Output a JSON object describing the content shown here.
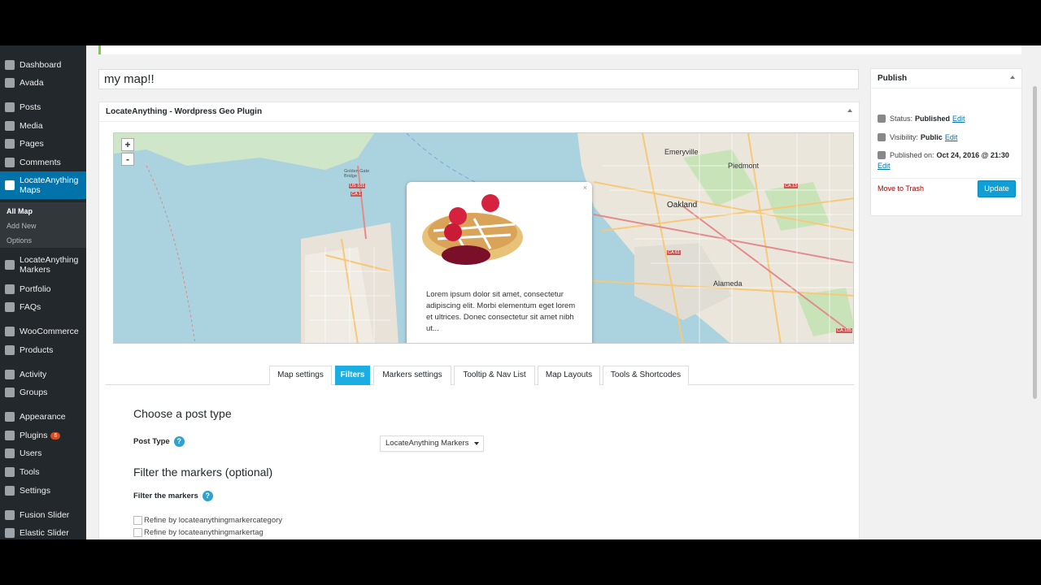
{
  "title_input": {
    "value": "my map!!"
  },
  "sidebar": {
    "items": [
      {
        "label": "Dashboard",
        "icon": "dashboard-icon"
      },
      {
        "label": "Avada",
        "icon": "avada-icon"
      },
      {
        "label": "Posts",
        "icon": "pin-icon"
      },
      {
        "label": "Media",
        "icon": "media-icon"
      },
      {
        "label": "Pages",
        "icon": "pages-icon"
      },
      {
        "label": "Comments",
        "icon": "comments-icon"
      },
      {
        "label": "LocateAnything Maps",
        "icon": "globe-icon",
        "active": true
      },
      {
        "label": "LocateAnything Markers",
        "icon": "pin-icon"
      },
      {
        "label": "Portfolio",
        "icon": "pin-icon"
      },
      {
        "label": "FAQs",
        "icon": "pin-icon"
      },
      {
        "label": "WooCommerce",
        "icon": "woocommerce-icon"
      },
      {
        "label": "Products",
        "icon": "products-icon"
      },
      {
        "label": "Activity",
        "icon": "activity-icon"
      },
      {
        "label": "Groups",
        "icon": "groups-icon"
      },
      {
        "label": "Appearance",
        "icon": "brush-icon"
      },
      {
        "label": "Plugins",
        "icon": "plugins-icon",
        "badge": "6"
      },
      {
        "label": "Users",
        "icon": "users-icon"
      },
      {
        "label": "Tools",
        "icon": "tools-icon"
      },
      {
        "label": "Settings",
        "icon": "settings-icon"
      },
      {
        "label": "Fusion Slider",
        "icon": "pin-icon"
      },
      {
        "label": "Elastic Slider",
        "icon": "pin-icon"
      }
    ],
    "submenu": [
      "All Map",
      "Add New",
      "Options"
    ]
  },
  "plugin_box": {
    "title": "LocateAnything - Wordpress Geo Plugin",
    "map": {
      "zoom_in": "+",
      "zoom_out": "-",
      "labels": [
        "Emeryville",
        "Piedmont",
        "Oakland",
        "Alameda",
        "Golden Gate Bridge",
        "US 101",
        "CA 1",
        "CA 13",
        "CA 61",
        "CA 185"
      ],
      "popup": {
        "close": "×",
        "text": "Lorem ipsum dolor sit amet, consectetur adipiscing elit. Morbi elementum eget lorem et ultrices. Donec consectetur sit amet nibh ut..."
      }
    },
    "tabs": [
      {
        "label": "Map settings",
        "active": false
      },
      {
        "label": "Filters",
        "active": true
      },
      {
        "label": "Markers settings",
        "active": false
      },
      {
        "label": "Tooltip & Nav List",
        "active": false
      },
      {
        "label": "Map Layouts",
        "active": false
      },
      {
        "label": "Tools & Shortcodes",
        "active": false
      }
    ],
    "choose_post_type": {
      "heading": "Choose a post type",
      "label": "Post Type",
      "help": "?",
      "selected": "LocateAnything Markers"
    },
    "filter_markers": {
      "heading": "Filter the markers (optional)",
      "label": "Filter the markers",
      "help": "?",
      "options": [
        "Refine by locateanythingmarkercategory",
        "Refine by locateanythingmarkertag"
      ]
    }
  },
  "publish": {
    "title": "Publish",
    "status_label": "Status:",
    "status_value": "Published",
    "visibility_label": "Visibility:",
    "visibility_value": "Public",
    "published_label": "Published on:",
    "published_value": "Oct 24, 2016 @ 21:30",
    "edit": "Edit",
    "trash": "Move to Trash",
    "update": "Update"
  },
  "colors": {
    "sidebar_bg": "#23282d",
    "active_menu": "#0073aa",
    "active_tab": "#1cade2",
    "update_button": "#0f9ed5"
  }
}
